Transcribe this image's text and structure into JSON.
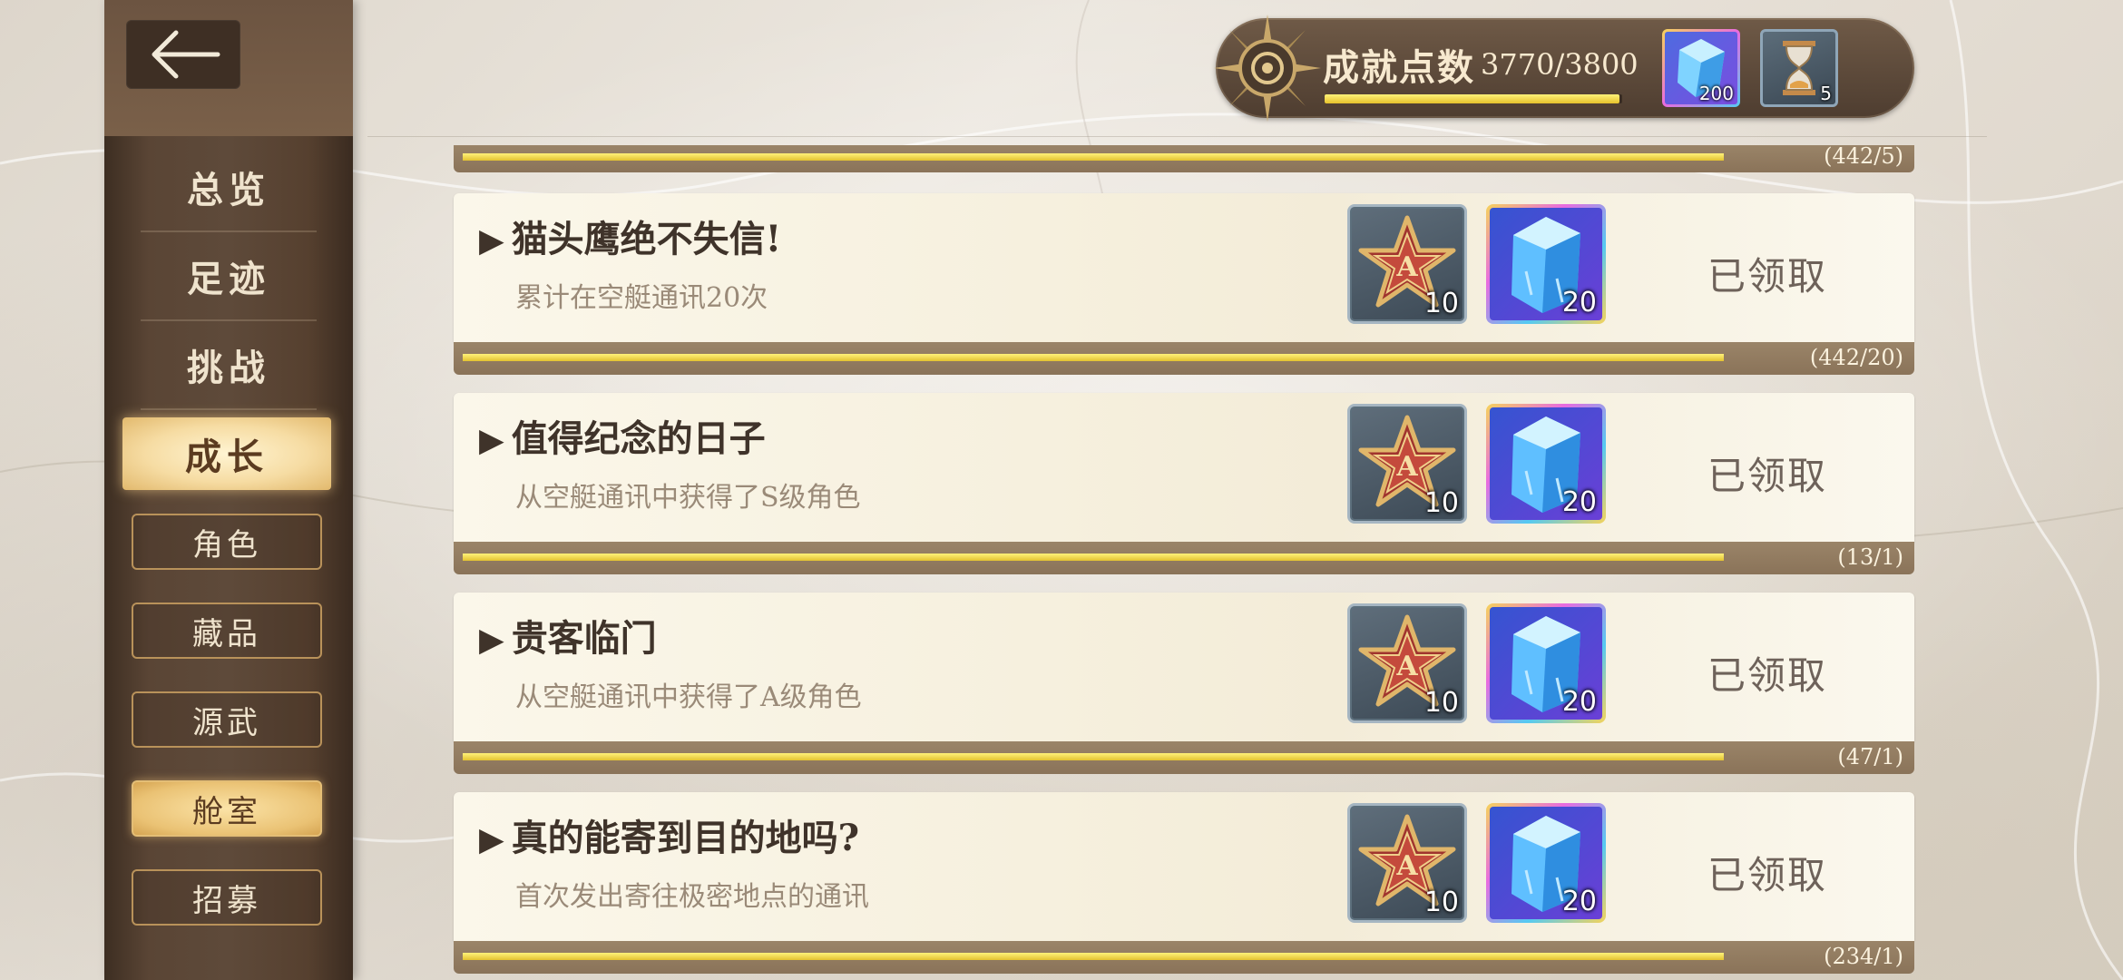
{
  "header": {
    "points_label": "成就点数",
    "points_value": "3770/3800",
    "points_progress": 0.992,
    "items": [
      {
        "icon": "crystal-icon",
        "count": "200"
      },
      {
        "icon": "hourglass-icon",
        "count": "5"
      }
    ]
  },
  "sidebar": {
    "back_icon": "back-arrow-icon",
    "main_items": [
      {
        "label": "总览",
        "active": false
      },
      {
        "label": "足迹",
        "active": false
      },
      {
        "label": "挑战",
        "active": false
      },
      {
        "label": "成长",
        "active": true
      }
    ],
    "sub_items": [
      {
        "label": "角色",
        "active": false
      },
      {
        "label": "藏品",
        "active": false
      },
      {
        "label": "源武",
        "active": false
      },
      {
        "label": "舱室",
        "active": true
      },
      {
        "label": "招募",
        "active": false
      }
    ]
  },
  "partial_row": {
    "count": "(442/5)",
    "progress": 1.0
  },
  "achievements": [
    {
      "title": "猫头鹰绝不失信!",
      "description": "累计在空艇通讯20次",
      "rewards": [
        {
          "icon": "a-star-icon",
          "count": "10"
        },
        {
          "icon": "crystal-icon",
          "count": "20"
        }
      ],
      "status": "已领取",
      "progress_text": "(442/20)",
      "progress": 1.0
    },
    {
      "title": "值得纪念的日子",
      "description": "从空艇通讯中获得了S级角色",
      "rewards": [
        {
          "icon": "a-star-icon",
          "count": "10"
        },
        {
          "icon": "crystal-icon",
          "count": "20"
        }
      ],
      "status": "已领取",
      "progress_text": "(13/1)",
      "progress": 1.0
    },
    {
      "title": "贵客临门",
      "description": "从空艇通讯中获得了A级角色",
      "rewards": [
        {
          "icon": "a-star-icon",
          "count": "10"
        },
        {
          "icon": "crystal-icon",
          "count": "20"
        }
      ],
      "status": "已领取",
      "progress_text": "(47/1)",
      "progress": 1.0
    },
    {
      "title": "真的能寄到目的地吗?",
      "description": "首次发出寄往极密地点的通讯",
      "rewards": [
        {
          "icon": "a-star-icon",
          "count": "10"
        },
        {
          "icon": "crystal-icon",
          "count": "20"
        }
      ],
      "status": "已领取",
      "progress_text": "(234/1)",
      "progress": 1.0
    }
  ]
}
